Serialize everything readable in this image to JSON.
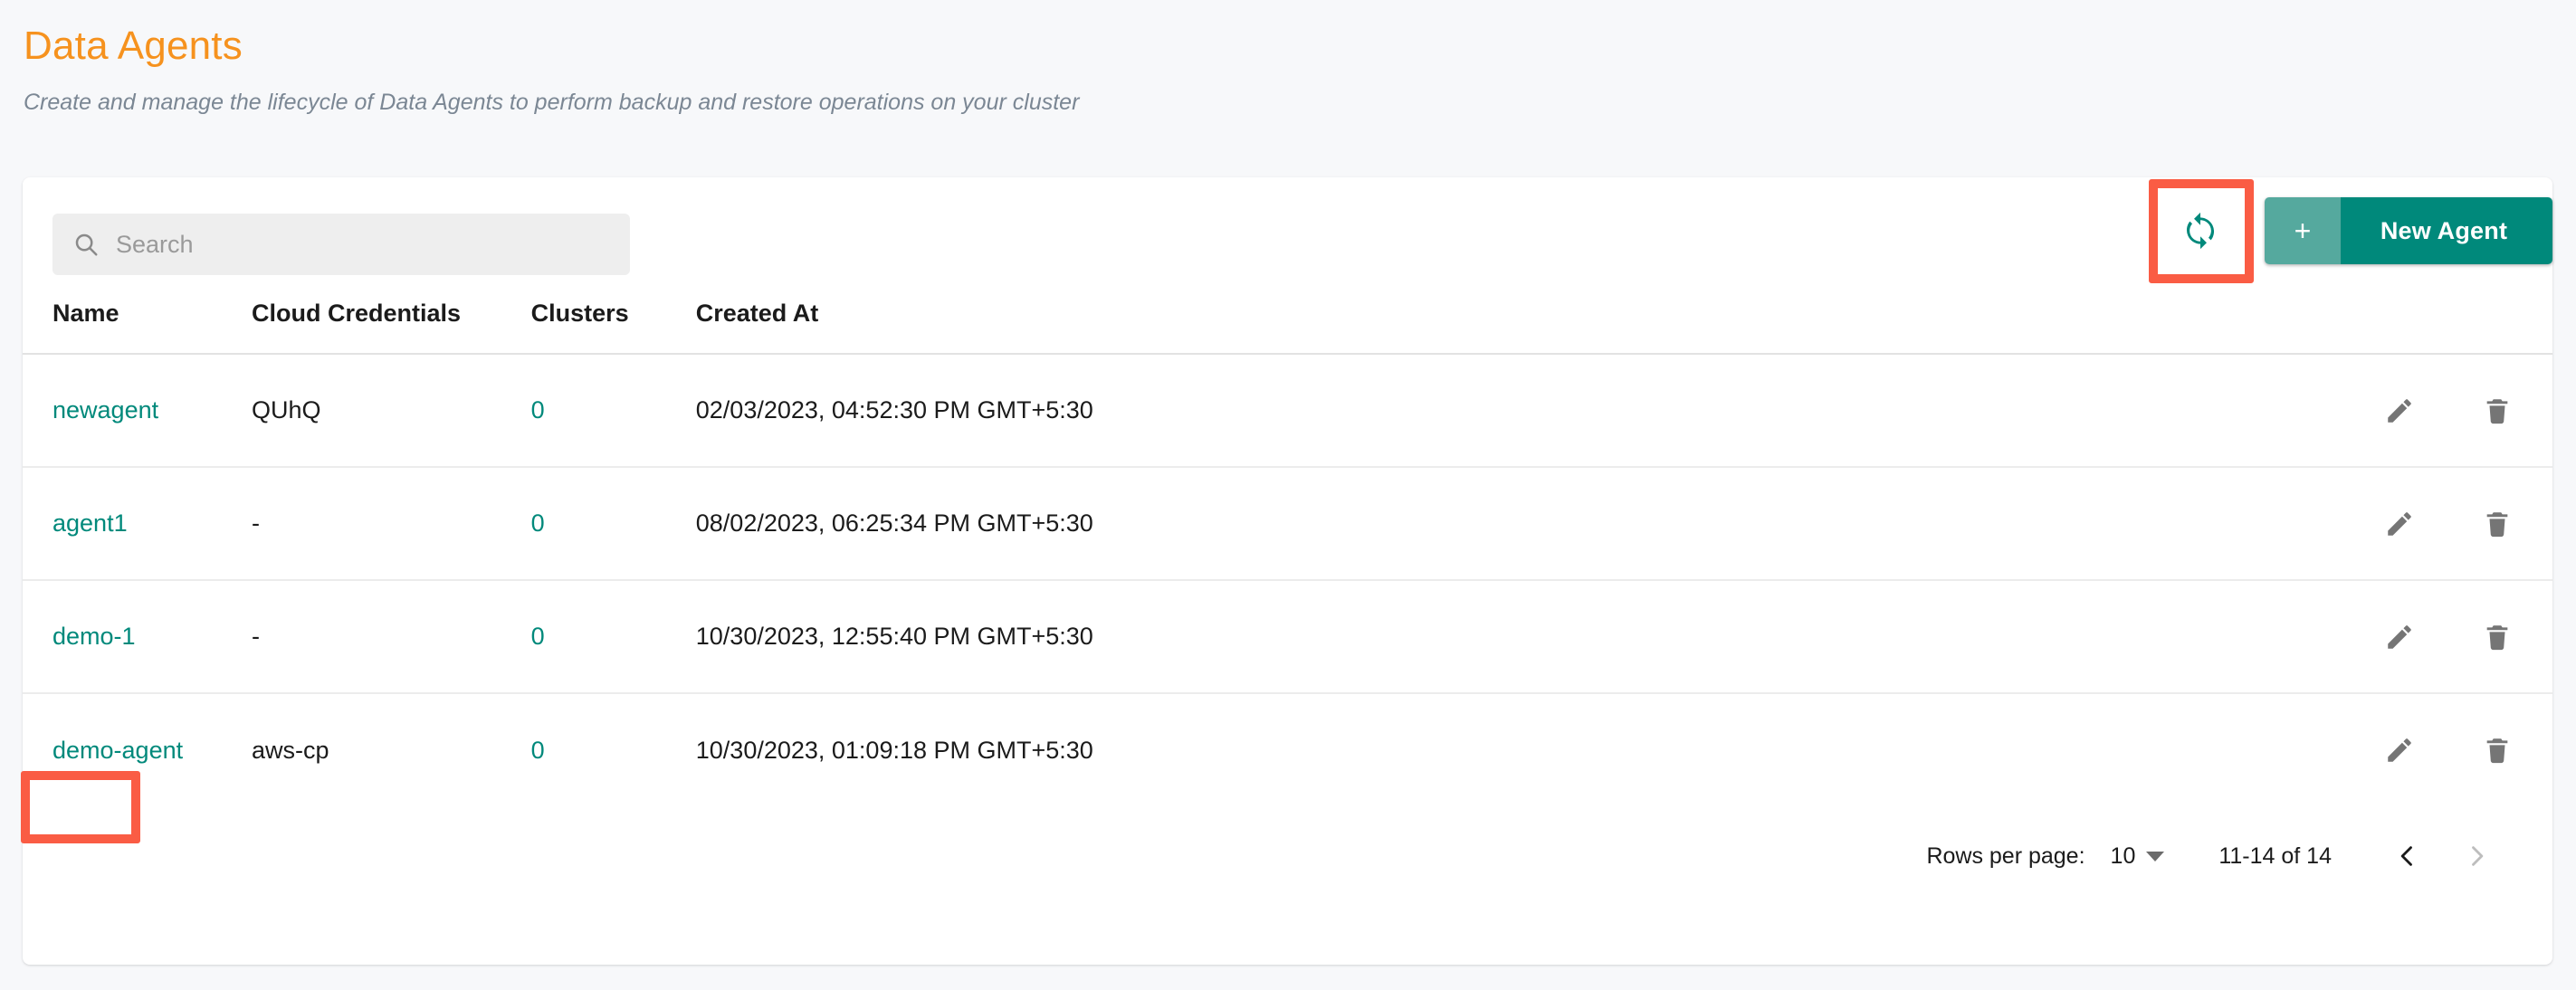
{
  "header": {
    "title": "Data Agents",
    "subtitle": "Create and manage the lifecycle of Data Agents to perform backup and restore operations on your cluster"
  },
  "toolbar": {
    "search_placeholder": "Search",
    "search_value": "",
    "search_icon": "search-icon",
    "refresh_icon": "refresh-icon",
    "new_agent_plus": "+",
    "new_agent_label": "New Agent"
  },
  "table": {
    "columns": [
      "Name",
      "Cloud Credentials",
      "Clusters",
      "Created At",
      ""
    ],
    "rows": [
      {
        "name": "newagent",
        "credentials": "QUhQ",
        "clusters": "0",
        "created_at": "02/03/2023, 04:52:30 PM GMT+5:30",
        "edit_icon": "pencil-icon",
        "delete_icon": "trash-icon"
      },
      {
        "name": "agent1",
        "credentials": "-",
        "clusters": "0",
        "created_at": "08/02/2023, 06:25:34 PM GMT+5:30",
        "edit_icon": "pencil-icon",
        "delete_icon": "trash-icon"
      },
      {
        "name": "demo-1",
        "credentials": "-",
        "clusters": "0",
        "created_at": "10/30/2023, 12:55:40 PM GMT+5:30",
        "edit_icon": "pencil-icon",
        "delete_icon": "trash-icon"
      },
      {
        "name": "demo-agent",
        "credentials": "aws-cp",
        "clusters": "0",
        "created_at": "10/30/2023, 01:09:18 PM GMT+5:30",
        "edit_icon": "pencil-icon",
        "delete_icon": "trash-icon"
      }
    ]
  },
  "pagination": {
    "rows_per_page_label": "Rows per page:",
    "rows_per_page_value": "10",
    "range_label": "11-14 of 14",
    "prev_icon": "chevron-left-icon",
    "next_icon": "chevron-right-icon"
  },
  "colors": {
    "title": "#f6921e",
    "accent_teal": "#00897b",
    "highlight_red": "#fa5c44",
    "page_background": "#f7f8fa"
  }
}
